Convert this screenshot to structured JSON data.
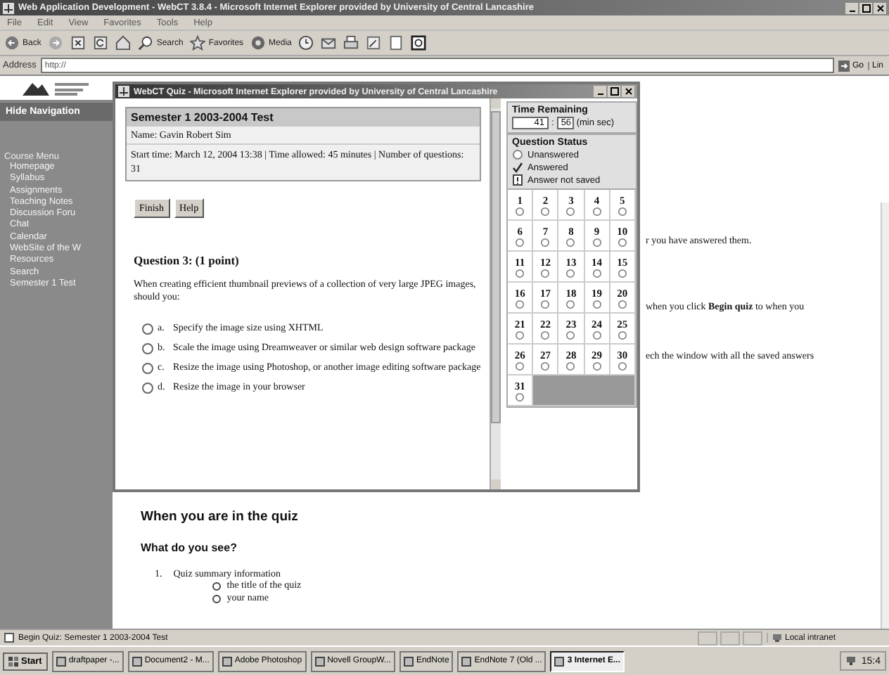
{
  "browser": {
    "title": "Web Application Development - WebCT 3.8.4 - Microsoft Internet Explorer provided by University of Central Lancashire",
    "menu": [
      "File",
      "Edit",
      "View",
      "Favorites",
      "Tools",
      "Help"
    ],
    "toolbar": [
      {
        "kind": "back",
        "label": "Back"
      },
      {
        "kind": "forward"
      },
      {
        "kind": "stop"
      },
      {
        "kind": "refresh"
      },
      {
        "kind": "home"
      },
      {
        "kind": "search",
        "label": "Search"
      },
      {
        "kind": "favorites",
        "label": "Favorites"
      },
      {
        "kind": "media",
        "label": "Media"
      },
      {
        "kind": "history"
      },
      {
        "kind": "mail"
      },
      {
        "kind": "print"
      },
      {
        "kind": "edit"
      },
      {
        "kind": "page"
      },
      {
        "kind": "messenger"
      }
    ],
    "address": {
      "label": "Address",
      "value": "http://",
      "go": "Go",
      "links": "Lin"
    }
  },
  "navigation": {
    "hide": "Hide Navigation",
    "menu_title": "Course Menu",
    "items": [
      "Homepage",
      "Syllabus",
      "Assignments",
      "Teaching Notes",
      "Discussion Foru",
      "Chat",
      "Calendar",
      "WebSite of the W",
      "Resources",
      "Search",
      "Semester 1 Test"
    ]
  },
  "page": {
    "partial_lines": [
      "r you have answered them.",
      "when you click **Begin quiz** to when you",
      "ech the window with all the saved answers"
    ],
    "heading": "When you are in the quiz",
    "subheading": "What do you see?",
    "list": [
      {
        "number": "1.",
        "text": "Quiz summary information",
        "children": [
          {
            "text": "the title of the quiz"
          },
          {
            "text": "your name"
          }
        ]
      }
    ]
  },
  "quiz_window": {
    "title": "WebCT Quiz - Microsoft Internet Explorer provided by University of Central Lancashire",
    "summary": {
      "title": "Semester 1 2003-2004 Test",
      "name": "Name: Gavin Robert Sim",
      "details": "Start time: March 12, 2004 13:38 | Time allowed: 45 minutes | Number of questions: 31"
    },
    "buttons": [
      "Finish",
      "Help"
    ],
    "question": {
      "title": "Question 3:  (1 point)",
      "text": "When creating efficient thumbnail previews of a collection of very large JPEG images, should you:",
      "options": [
        {
          "letter": "a.",
          "text": "Specify the image size using XHTML",
          "selected": false
        },
        {
          "letter": "b.",
          "text": "Scale the image using Dreamweaver or similar web design software package",
          "selected": false
        },
        {
          "letter": "c.",
          "text": "Resize the image using Photoshop, or another image editing software package",
          "selected": false
        },
        {
          "letter": "d.",
          "text": "Resize the image in your browser",
          "selected": false
        }
      ]
    },
    "timer": {
      "title": "Time Remaining",
      "minutes": "41",
      "separator": ":",
      "seconds": "56",
      "unit": "(min sec)"
    },
    "status": {
      "title": "Question Status",
      "legend": [
        {
          "kind": "unanswered",
          "label": "Unanswered"
        },
        {
          "kind": "answered",
          "label": "Answered"
        },
        {
          "kind": "not_saved",
          "label": "Answer not saved"
        }
      ]
    },
    "questions": [
      {
        "number": "1",
        "answered": false
      },
      {
        "number": "2",
        "answered": false
      },
      {
        "number": "3",
        "answered": false
      },
      {
        "number": "4",
        "answered": false
      },
      {
        "number": "5",
        "answered": false
      },
      {
        "number": "6",
        "answered": false
      },
      {
        "number": "7",
        "answered": false
      },
      {
        "number": "8",
        "answered": false
      },
      {
        "number": "9",
        "answered": false
      },
      {
        "number": "10",
        "answered": false
      },
      {
        "number": "11",
        "answered": false
      },
      {
        "number": "12",
        "answered": false
      },
      {
        "number": "13",
        "answered": false
      },
      {
        "number": "14",
        "answered": false
      },
      {
        "number": "15",
        "answered": false
      },
      {
        "number": "16",
        "answered": false
      },
      {
        "number": "17",
        "answered": false
      },
      {
        "number": "18",
        "answered": false
      },
      {
        "number": "19",
        "answered": false
      },
      {
        "number": "20",
        "answered": false
      },
      {
        "number": "21",
        "answered": false
      },
      {
        "number": "22",
        "answered": false
      },
      {
        "number": "23",
        "answered": false
      },
      {
        "number": "24",
        "answered": false
      },
      {
        "number": "25",
        "answered": false
      },
      {
        "number": "26",
        "answered": false
      },
      {
        "number": "27",
        "answered": false
      },
      {
        "number": "28",
        "answered": false
      },
      {
        "number": "29",
        "answered": false
      },
      {
        "number": "30",
        "answered": false
      },
      {
        "number": "31",
        "answered": false
      }
    ]
  },
  "status_bar": {
    "text": "Begin Quiz: Semester 1 2003-2004 Test",
    "zone": "Local intranet"
  },
  "taskbar": {
    "start": "Start",
    "tasks": [
      {
        "label": "draftpaper -...",
        "selected": false
      },
      {
        "label": "Document2 - M...",
        "selected": false
      },
      {
        "label": "Adobe Photoshop",
        "selected": false
      },
      {
        "label": "Novell GroupW...",
        "selected": false
      },
      {
        "label": "EndNote",
        "selected": false
      },
      {
        "label": "EndNote 7 (Old ...",
        "selected": false
      },
      {
        "label": "3 Internet E...",
        "selected": true
      }
    ],
    "clock": "15:4"
  }
}
